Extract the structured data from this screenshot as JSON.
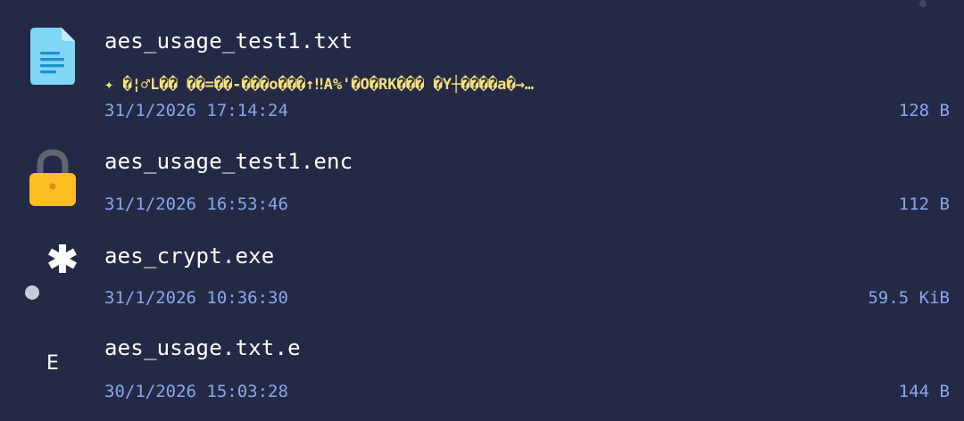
{
  "files": [
    {
      "name": "aes_usage_test1.txt",
      "icon": "text-document-icon",
      "preview": "✦ �¦♂L�� ��=��-���o���↑‼A%'�O�RK��� �Y┼����a�→…",
      "date": "31/1/2026 17:14:24",
      "size": "128 B"
    },
    {
      "name": "aes_usage_test1.enc",
      "icon": "lock-icon",
      "date": "31/1/2026 16:53:46",
      "size": "112 B"
    },
    {
      "name": "aes_crypt.exe",
      "icon": "asterisk-icon",
      "date": "31/1/2026 10:36:30",
      "size": "59.5 KiB"
    },
    {
      "name": "aes_usage.txt.e",
      "icon": "letter-e-icon",
      "icon_glyph": "E",
      "date": "30/1/2026 15:03:28",
      "size": "144 B"
    }
  ],
  "colors": {
    "background": "#242a45",
    "name": "#ffffff",
    "preview": "#f4e07a",
    "meta": "#8aa6ee",
    "doc_icon": "#7fd6f5",
    "lock_body": "#fbbf24",
    "lock_shackle": "#60646e"
  }
}
